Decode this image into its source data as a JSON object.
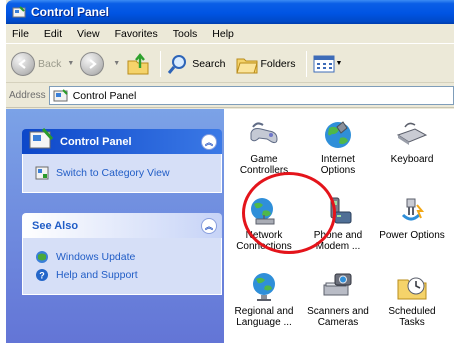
{
  "window": {
    "title": "Control Panel"
  },
  "menu": [
    "File",
    "Edit",
    "View",
    "Favorites",
    "Tools",
    "Help"
  ],
  "toolbar": {
    "back": "Back",
    "search": "Search",
    "folders": "Folders"
  },
  "address": {
    "label": "Address",
    "value": "Control Panel"
  },
  "sidebar": {
    "panel1": {
      "title": "Control Panel",
      "link": "Switch to Category View"
    },
    "panel2": {
      "title": "See Also",
      "links": [
        "Windows Update",
        "Help and Support"
      ]
    }
  },
  "items": [
    {
      "label1": "Game",
      "label2": "Controllers",
      "icon": "game-controller-icon"
    },
    {
      "label1": "Internet",
      "label2": "Options",
      "icon": "internet-options-icon"
    },
    {
      "label1": "Keyboard",
      "label2": "",
      "icon": "keyboard-icon"
    },
    {
      "label1": "Network",
      "label2": "Connections",
      "icon": "network-connections-icon"
    },
    {
      "label1": "Phone and",
      "label2": "Modem ...",
      "icon": "phone-modem-icon"
    },
    {
      "label1": "Power Options",
      "label2": "",
      "icon": "power-options-icon"
    },
    {
      "label1": "Regional and",
      "label2": "Language ...",
      "icon": "regional-language-icon"
    },
    {
      "label1": "Scanners and",
      "label2": "Cameras",
      "icon": "scanner-camera-icon"
    },
    {
      "label1": "Scheduled",
      "label2": "Tasks",
      "icon": "scheduled-tasks-icon"
    }
  ],
  "colors": {
    "titlebar": "#0054e3",
    "sidebar": "#6e8ee0",
    "link": "#215dc6",
    "highlight": "#e4141b"
  }
}
